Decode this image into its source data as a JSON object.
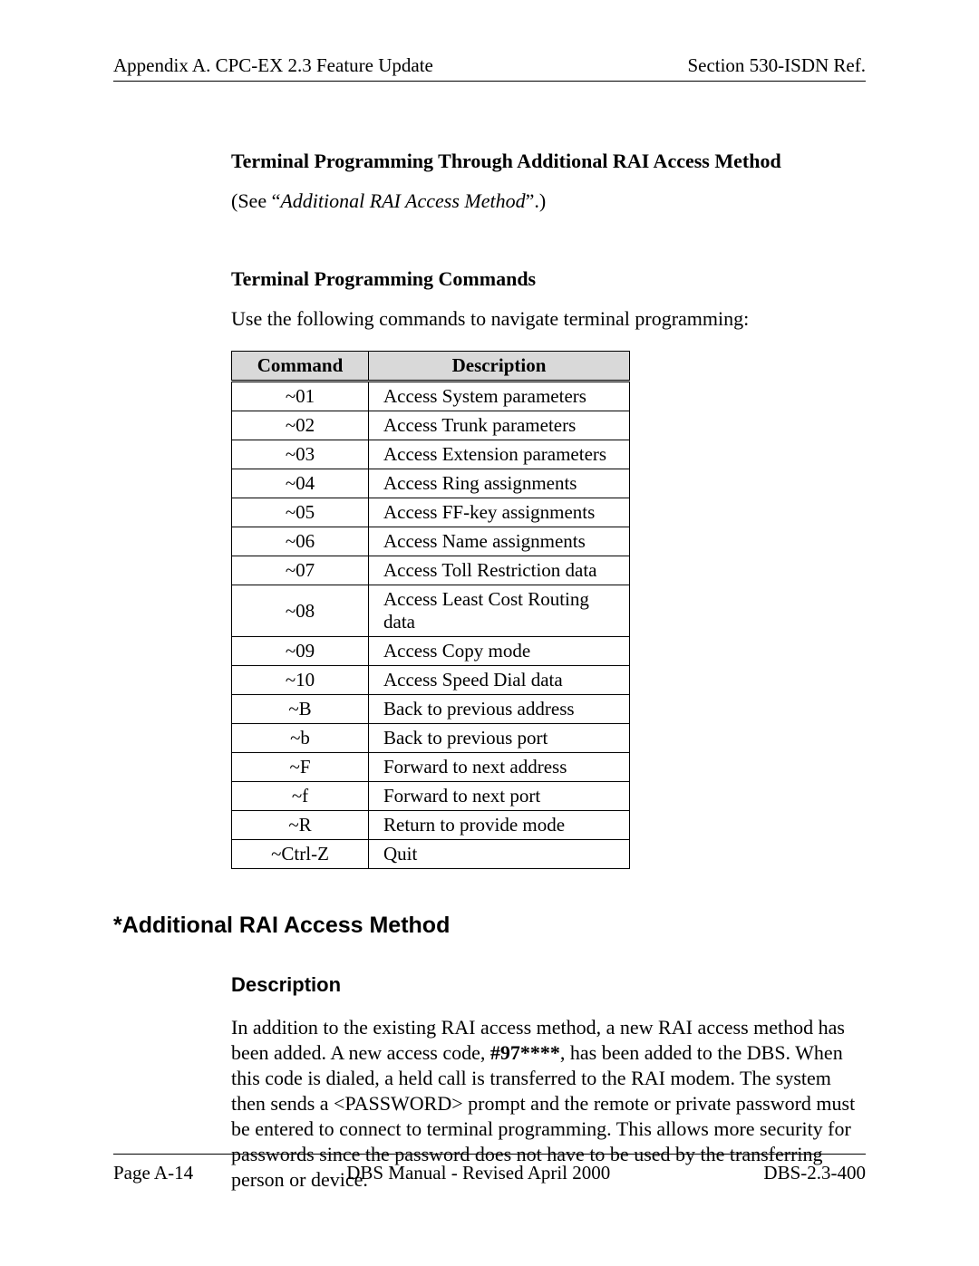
{
  "header": {
    "left": "Appendix A. CPC-EX 2.3 Feature Update",
    "right": "Section 530-ISDN Ref."
  },
  "section1": {
    "heading": "Terminal Programming Through Additional RAI Access Method",
    "see_prefix": "(See “",
    "see_italic": "Additional RAI Access Method",
    "see_suffix": "”.)"
  },
  "section2": {
    "heading": "Terminal Programming Commands",
    "intro": "Use the following commands to navigate terminal programming:"
  },
  "table": {
    "headers": {
      "cmd": "Command",
      "desc": "Description"
    },
    "rows": [
      {
        "cmd": "~01",
        "desc": "Access System parameters"
      },
      {
        "cmd": "~02",
        "desc": "Access Trunk parameters"
      },
      {
        "cmd": "~03",
        "desc": "Access Extension parameters"
      },
      {
        "cmd": "~04",
        "desc": "Access Ring assignments"
      },
      {
        "cmd": "~05",
        "desc": "Access FF-key assignments"
      },
      {
        "cmd": "~06",
        "desc": "Access Name assignments"
      },
      {
        "cmd": "~07",
        "desc": "Access Toll Restriction data"
      },
      {
        "cmd": "~08",
        "desc": "Access Least Cost Routing data"
      },
      {
        "cmd": "~09",
        "desc": "Access Copy mode"
      },
      {
        "cmd": "~10",
        "desc": "Access Speed Dial data"
      },
      {
        "cmd": "~B",
        "desc": "Back to previous address"
      },
      {
        "cmd": "~b",
        "desc": "Back to previous port"
      },
      {
        "cmd": "~F",
        "desc": "Forward to next address"
      },
      {
        "cmd": "~f",
        "desc": "Forward to next port"
      },
      {
        "cmd": "~R",
        "desc": "Return to provide mode"
      },
      {
        "cmd": "~Ctrl-Z",
        "desc": "Quit"
      }
    ]
  },
  "section3": {
    "title": "*Additional RAI Access Method",
    "desc_heading": "Description",
    "para_before": "In addition to the existing RAI access method, a new RAI access method has been added. A new access code, ",
    "code": "#97****",
    "para_after": ", has been added to the DBS. When this code is dialed, a held call is transferred to the RAI modem. The system then sends a <PASSWORD> prompt and the remote or private password must be entered to connect to terminal programming. This allows more security for passwords since the password does not have to be used by the transferring person or device."
  },
  "footer": {
    "left": "Page A-14",
    "center": "DBS Manual - Revised April 2000",
    "right": "DBS-2.3-400"
  }
}
